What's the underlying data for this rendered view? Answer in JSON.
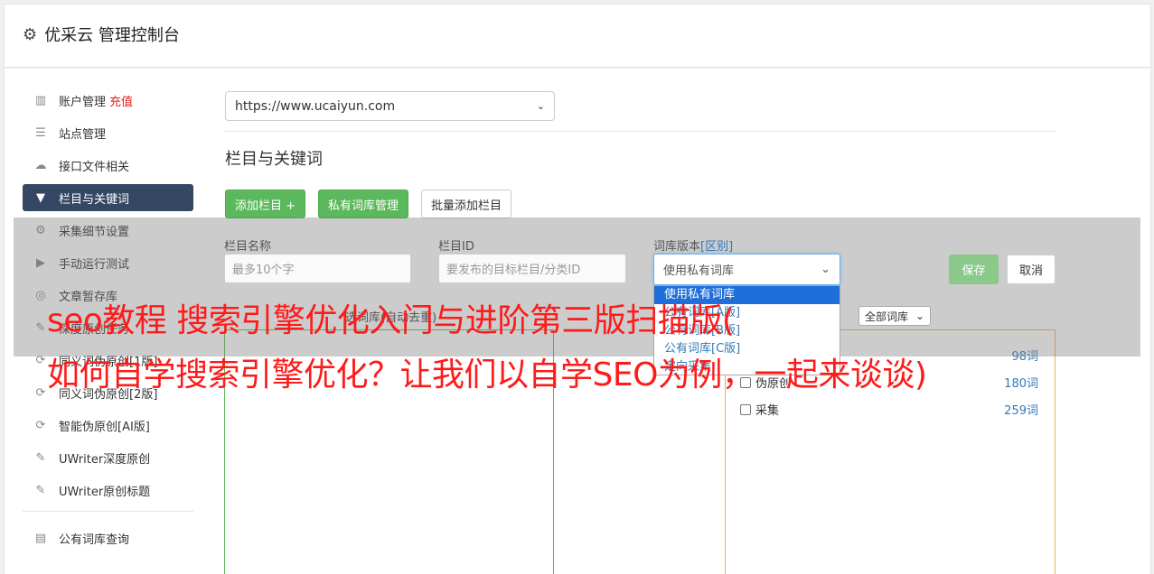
{
  "header": {
    "title": "优采云 管理控制台"
  },
  "sidebar": {
    "items": [
      {
        "label": "账户管理",
        "extra": "充值",
        "icon": "bar-chart-icon"
      },
      {
        "label": "站点管理",
        "icon": "server-icon"
      },
      {
        "label": "接口文件相关",
        "icon": "cloud-upload-icon"
      },
      {
        "label": "栏目与关键词",
        "icon": "filter-icon",
        "active": true
      },
      {
        "label": "采集细节设置",
        "icon": "cogs-icon"
      },
      {
        "label": "手动运行测试",
        "icon": "play-circle-icon"
      },
      {
        "label": "文章暂存库",
        "icon": "database-icon"
      },
      {
        "label": "深度原创任务",
        "icon": "edit-icon"
      },
      {
        "label": "同义词伪原创[1版]",
        "icon": "refresh-icon"
      },
      {
        "label": "同义词伪原创[2版]",
        "icon": "refresh-icon"
      },
      {
        "label": "智能伪原创[AI版]",
        "icon": "refresh-icon"
      },
      {
        "label": "UWriter深度原创",
        "icon": "edit-icon"
      },
      {
        "label": "UWriter原创标题",
        "icon": "edit-icon"
      },
      {
        "label": "公有词库查询",
        "icon": "book-icon"
      }
    ]
  },
  "main": {
    "site_select": "https://www.ucaiyun.com",
    "section_title": "栏目与关键词",
    "buttons": {
      "add_column": "添加栏目 +",
      "private_lib": "私有词库管理",
      "batch_add": "批量添加栏目"
    },
    "form": {
      "name_label": "栏目名称",
      "name_placeholder": "最多10个字",
      "id_label": "栏目ID",
      "id_placeholder": "要发布的目标栏目/分类ID",
      "version_label": "词库版本",
      "version_label_link": "[区别]",
      "version_selected": "使用私有词库",
      "version_options": [
        "使用私有词库",
        "公有词库[A版]",
        "公有词库[B版]",
        "公有词库[C版]",
        "定向采集"
      ],
      "save": "保存",
      "cancel": "取消"
    },
    "sub_hint": "选词库(自动去重)",
    "lib_filter": "全部词库",
    "lib_rows": [
      {
        "label": "伪原创",
        "count": "180词"
      },
      {
        "label": "采集",
        "count": "259词"
      }
    ],
    "lib_top_count": "98词"
  },
  "watermark": {
    "line1": "seo教程 搜索引擎优化入门与进阶第三版扫描版(",
    "line2": "如何自学搜索引擎优化？让我们以自学SEO为例，一起来谈谈)"
  }
}
